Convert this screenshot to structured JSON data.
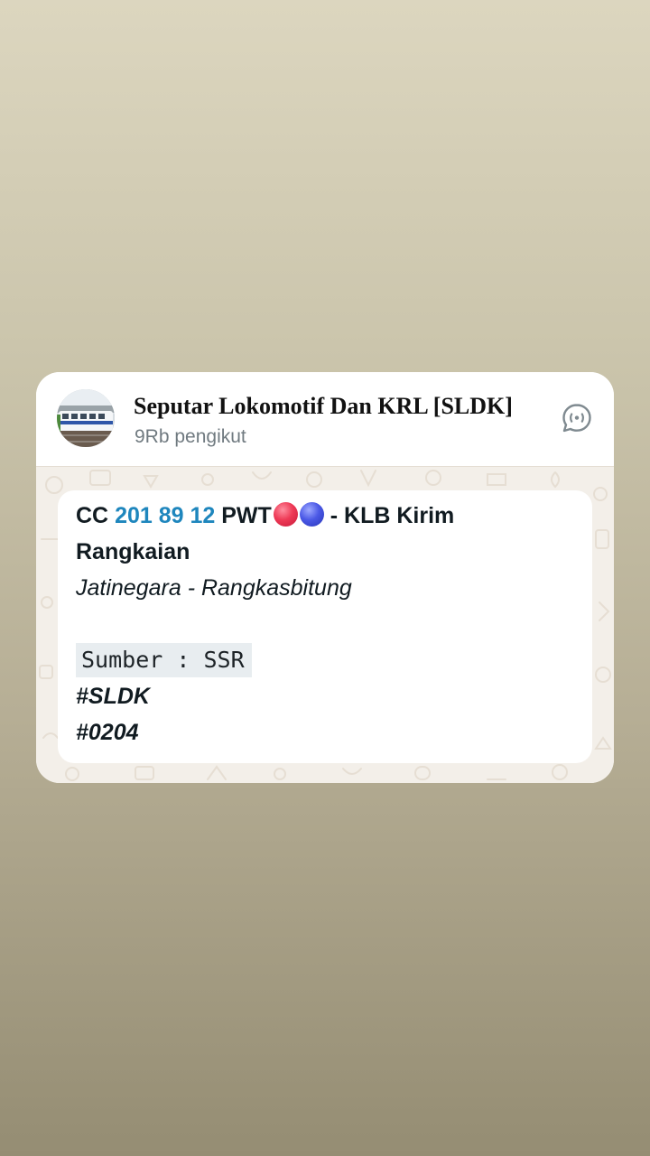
{
  "channel": {
    "name": "Seputar Lokomotif Dan KRL [SLDK]",
    "followers": "9Rb pengikut",
    "avatar_icon": "train-photo-avatar",
    "action_icon": "chat-bubble-icon"
  },
  "message": {
    "line1": {
      "prefix": "CC ",
      "number_1": "201",
      "number_2": "89",
      "number_3": "12",
      "suffix": " PWT",
      "emoji_1": "red-circle",
      "emoji_2": "blue-circle",
      "tail": " - KLB Kirim"
    },
    "line2": "Rangkaian",
    "route": "Jatinegara - Rangkasbitung",
    "source_label": "Sumber : SSR",
    "hashtag_1": "#SLDK",
    "hashtag_2": "#0204"
  },
  "colors": {
    "link_blue": "#1e86bd",
    "card_bg": "#ffffff",
    "chat_wallpaper": "#f3efe9",
    "code_bg": "#e8edf0"
  }
}
